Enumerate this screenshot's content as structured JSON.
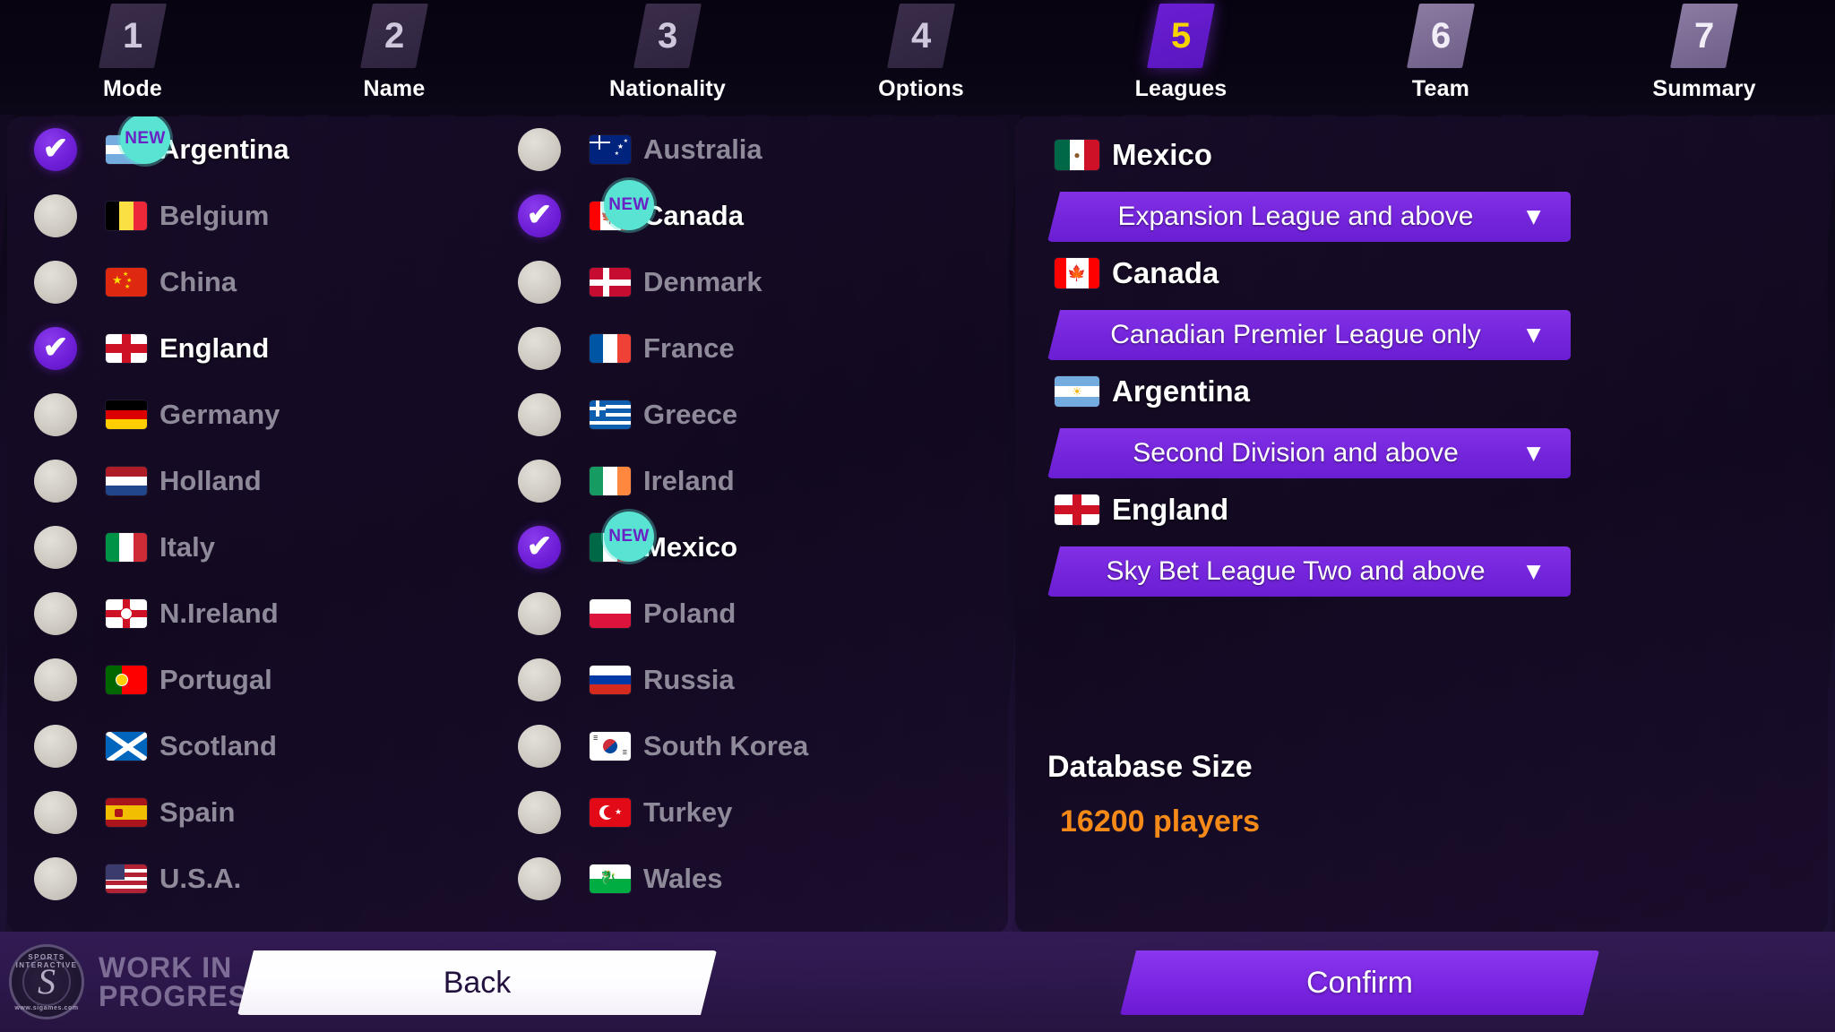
{
  "steps": [
    {
      "num": "1",
      "label": "Mode",
      "state": "past"
    },
    {
      "num": "2",
      "label": "Name",
      "state": "past"
    },
    {
      "num": "3",
      "label": "Nationality",
      "state": "past"
    },
    {
      "num": "4",
      "label": "Options",
      "state": "past"
    },
    {
      "num": "5",
      "label": "Leagues",
      "state": "active"
    },
    {
      "num": "6",
      "label": "Team",
      "state": "future"
    },
    {
      "num": "7",
      "label": "Summary",
      "state": "future"
    }
  ],
  "countries_left": [
    {
      "name": "Argentina",
      "selected": true,
      "new": true,
      "flag": "ar"
    },
    {
      "name": "Belgium",
      "selected": false,
      "new": false,
      "flag": "be"
    },
    {
      "name": "China",
      "selected": false,
      "new": false,
      "flag": "cn"
    },
    {
      "name": "England",
      "selected": true,
      "new": false,
      "flag": "en"
    },
    {
      "name": "Germany",
      "selected": false,
      "new": false,
      "flag": "de"
    },
    {
      "name": "Holland",
      "selected": false,
      "new": false,
      "flag": "nl"
    },
    {
      "name": "Italy",
      "selected": false,
      "new": false,
      "flag": "it"
    },
    {
      "name": "N.Ireland",
      "selected": false,
      "new": false,
      "flag": "ni"
    },
    {
      "name": "Portugal",
      "selected": false,
      "new": false,
      "flag": "pt"
    },
    {
      "name": "Scotland",
      "selected": false,
      "new": false,
      "flag": "sc"
    },
    {
      "name": "Spain",
      "selected": false,
      "new": false,
      "flag": "es"
    },
    {
      "name": "U.S.A.",
      "selected": false,
      "new": false,
      "flag": "us"
    }
  ],
  "countries_right": [
    {
      "name": "Australia",
      "selected": false,
      "new": false,
      "flag": "au"
    },
    {
      "name": "Canada",
      "selected": true,
      "new": true,
      "flag": "ca"
    },
    {
      "name": "Denmark",
      "selected": false,
      "new": false,
      "flag": "dk"
    },
    {
      "name": "France",
      "selected": false,
      "new": false,
      "flag": "fr"
    },
    {
      "name": "Greece",
      "selected": false,
      "new": false,
      "flag": "gr"
    },
    {
      "name": "Ireland",
      "selected": false,
      "new": false,
      "flag": "ie"
    },
    {
      "name": "Mexico",
      "selected": true,
      "new": true,
      "flag": "mx"
    },
    {
      "name": "Poland",
      "selected": false,
      "new": false,
      "flag": "pl"
    },
    {
      "name": "Russia",
      "selected": false,
      "new": false,
      "flag": "ru"
    },
    {
      "name": "South Korea",
      "selected": false,
      "new": false,
      "flag": "kr"
    },
    {
      "name": "Turkey",
      "selected": false,
      "new": false,
      "flag": "tr"
    },
    {
      "name": "Wales",
      "selected": false,
      "new": false,
      "flag": "wa"
    }
  ],
  "new_badge_label": "NEW",
  "leagues": [
    {
      "country": "Mexico",
      "flag": "mx",
      "selection": "Expansion League and above"
    },
    {
      "country": "Canada",
      "flag": "ca",
      "selection": "Canadian Premier League only"
    },
    {
      "country": "Argentina",
      "flag": "ar",
      "selection": "Second Division and above"
    },
    {
      "country": "England",
      "flag": "en",
      "selection": "Sky Bet League Two and above"
    }
  ],
  "database": {
    "title": "Database Size",
    "value": "16200 players"
  },
  "footer": {
    "back_label": "Back",
    "confirm_label": "Confirm",
    "wip_line1": "WORK IN",
    "wip_line2": "PROGRESS",
    "logo_top": "SPORTS INTERACTIVE",
    "logo_bottom": "www.sigames.com",
    "logo_letter": "S"
  },
  "colors": {
    "accent_purple": "#7526dc",
    "active_step_number": "#f5d400",
    "db_value_orange": "#f58a18",
    "new_badge_bg": "#59e3d2",
    "new_badge_text": "#6a22c4",
    "panel_bg": "#150a26",
    "checkbox_on": "#6d1ed6",
    "checkbox_off": "#cfcbc3"
  },
  "icons": {
    "checkmark": "check-icon",
    "chevron": "chevron-down-icon"
  }
}
